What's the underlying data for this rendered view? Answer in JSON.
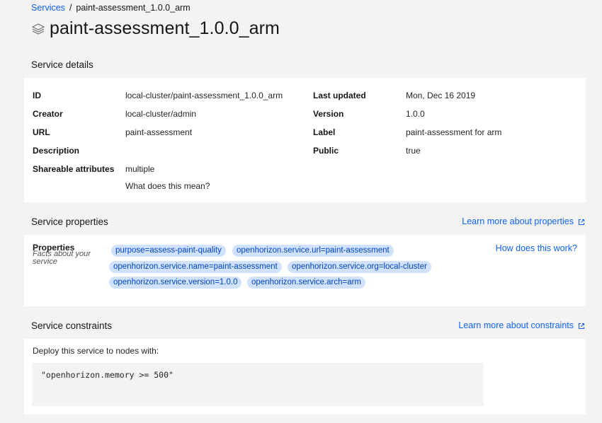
{
  "breadcrumb": {
    "parent": "Services",
    "separator": "/",
    "current": "paint-assessment_1.0.0_arm"
  },
  "page_title": "paint-assessment_1.0.0_arm",
  "service_details": {
    "heading": "Service details",
    "fields": {
      "id": {
        "label": "ID",
        "value": "local-cluster/paint-assessment_1.0.0_arm"
      },
      "creator": {
        "label": "Creator",
        "value": "local-cluster/admin"
      },
      "url": {
        "label": "URL",
        "value": "paint-assessment"
      },
      "description": {
        "label": "Description",
        "value": ""
      },
      "shareable": {
        "label": "Shareable attributes",
        "value": "multiple",
        "help_link": "What does this mean?"
      },
      "last_updated": {
        "label": "Last updated",
        "value": "Mon, Dec 16 2019"
      },
      "version": {
        "label": "Version",
        "value": "1.0.0"
      },
      "label": {
        "label": "Label",
        "value": "paint-assessment for arm"
      },
      "public": {
        "label": "Public",
        "value": "true"
      }
    }
  },
  "service_properties": {
    "heading": "Service properties",
    "learn_more": "Learn more about properties",
    "properties_label": "Properties",
    "properties_sub": "Facts about your service",
    "how_link": "How does this work?",
    "tags": [
      "purpose=assess-paint-quality",
      "openhorizon.service.url=paint-assessment",
      "openhorizon.service.name=paint-assessment",
      "openhorizon.service.org=local-cluster",
      "openhorizon.service.version=1.0.0",
      "openhorizon.service.arch=arm"
    ]
  },
  "service_constraints": {
    "heading": "Service constraints",
    "learn_more": "Learn more about constraints",
    "deploy_text": "Deploy this service to nodes with:",
    "constraint": "\"openhorizon.memory >= 500\""
  },
  "colors": {
    "link": "#0f62fe",
    "tag_bg": "#d0e2ff",
    "tag_text": "#0043ce",
    "page_bg": "#f3f3f3"
  }
}
